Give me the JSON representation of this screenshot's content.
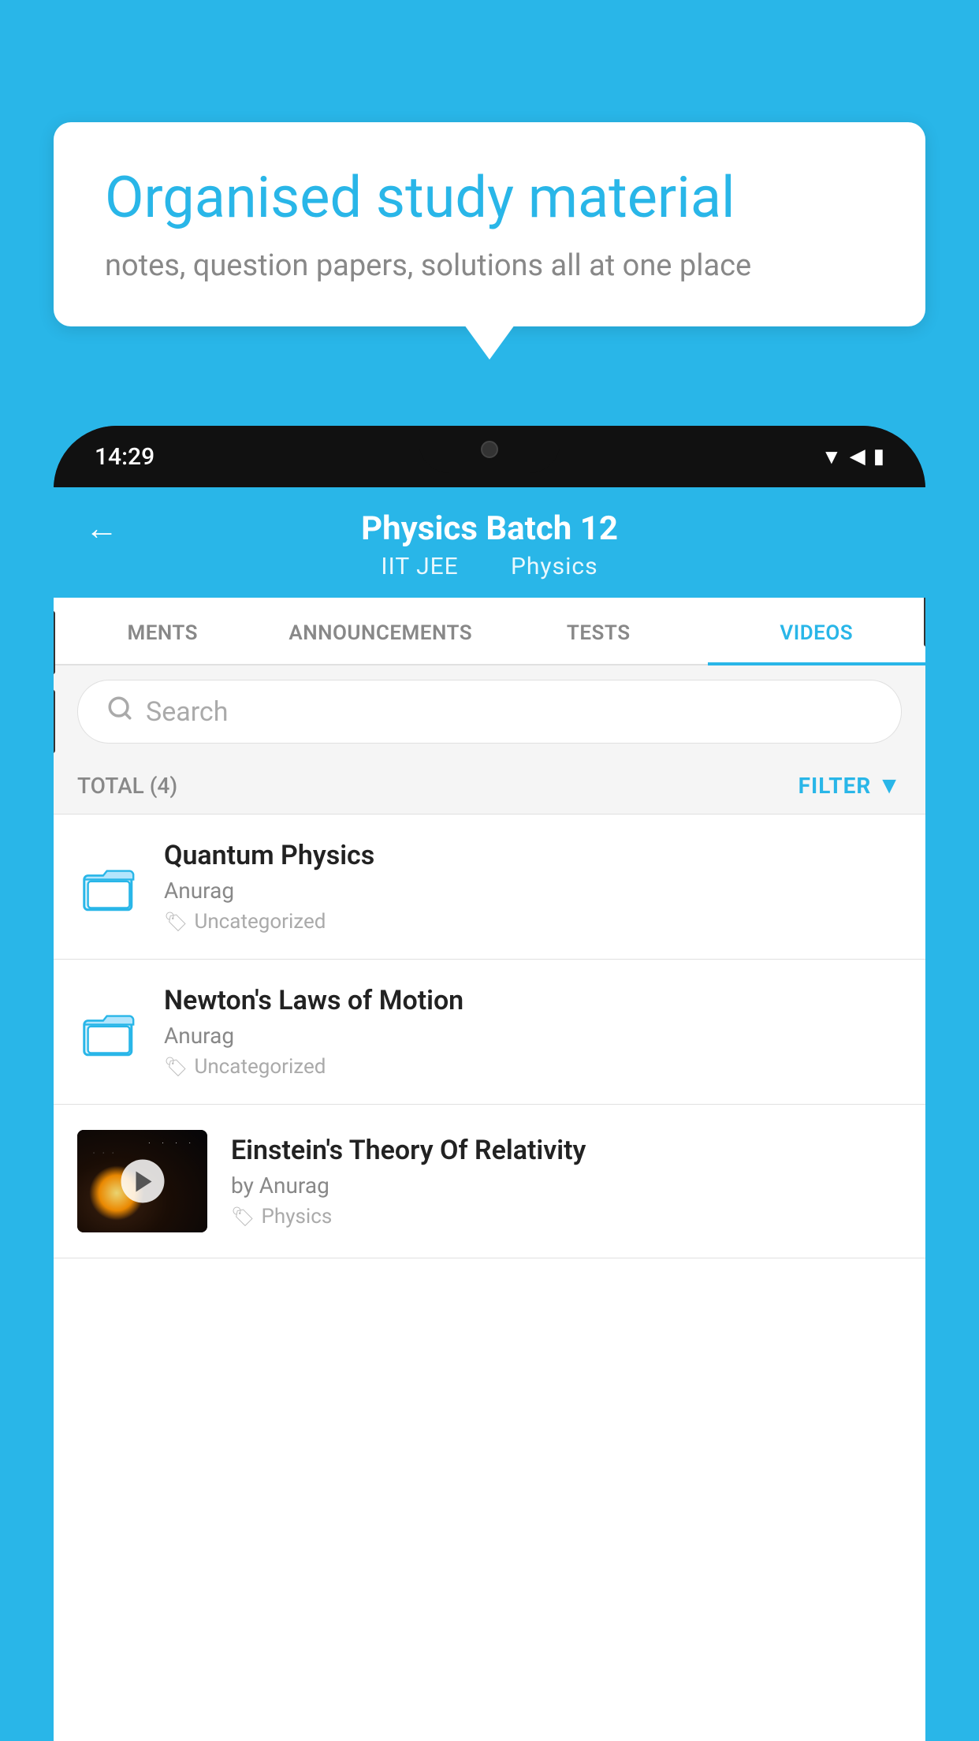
{
  "bubble": {
    "title": "Organised study material",
    "subtitle": "notes, question papers, solutions all at one place"
  },
  "phone": {
    "time": "14:29",
    "header": {
      "back_label": "←",
      "title": "Physics Batch 12",
      "tag1": "IIT JEE",
      "tag2": "Physics"
    },
    "tabs": [
      {
        "label": "MENTS",
        "active": false
      },
      {
        "label": "ANNOUNCEMENTS",
        "active": false
      },
      {
        "label": "TESTS",
        "active": false
      },
      {
        "label": "VIDEOS",
        "active": true
      }
    ],
    "search": {
      "placeholder": "Search"
    },
    "filter": {
      "total_label": "TOTAL (4)",
      "filter_label": "FILTER"
    },
    "videos": [
      {
        "type": "folder",
        "title": "Quantum Physics",
        "author": "Anurag",
        "tag": "Uncategorized",
        "has_thumbnail": false
      },
      {
        "type": "folder",
        "title": "Newton's Laws of Motion",
        "author": "Anurag",
        "tag": "Uncategorized",
        "has_thumbnail": false
      },
      {
        "type": "video",
        "title": "Einstein's Theory Of Relativity",
        "author": "by Anurag",
        "tag": "Physics",
        "has_thumbnail": true
      }
    ]
  }
}
